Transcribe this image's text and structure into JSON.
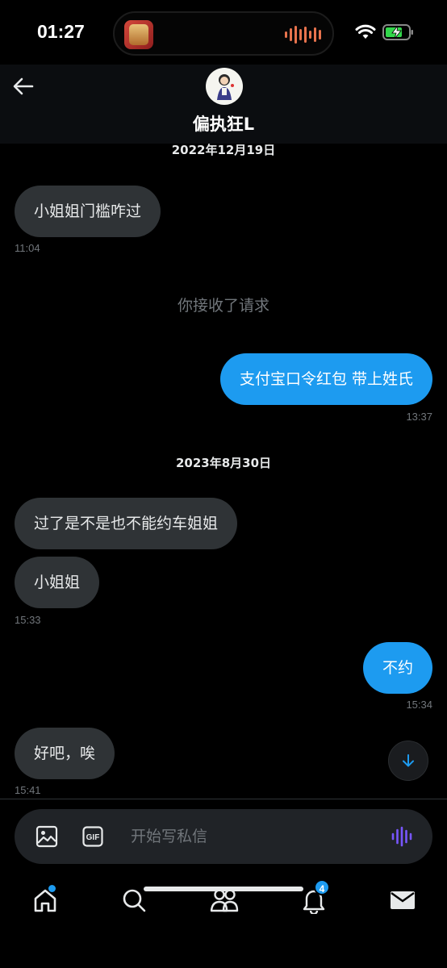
{
  "status_bar": {
    "time": "01:27"
  },
  "header": {
    "contact_name": "偏执狂L"
  },
  "messages": {
    "date_1": "2022年12月19日",
    "m1": {
      "text": "小姐姐门槛咋过",
      "time": "11:04"
    },
    "system_note": "你接收了请求",
    "m2": {
      "text": "支付宝口令红包 带上姓氏",
      "time": "13:37"
    },
    "date_2": "2023年8月30日",
    "m3": {
      "text": "过了是不是也不能约车姐姐"
    },
    "m4": {
      "text": "小姐姐",
      "time": "15:33"
    },
    "m5": {
      "text": "不约",
      "time": "15:34"
    },
    "m6": {
      "text": "好吧，唉",
      "time": "15:41"
    }
  },
  "composer": {
    "placeholder": "开始写私信"
  },
  "tabs": {
    "notifications_badge": "4"
  },
  "colors": {
    "accent": "#1d9bf0",
    "incoming_bubble": "#2f3336",
    "background": "#000000",
    "voice_accent": "#7856ff"
  }
}
